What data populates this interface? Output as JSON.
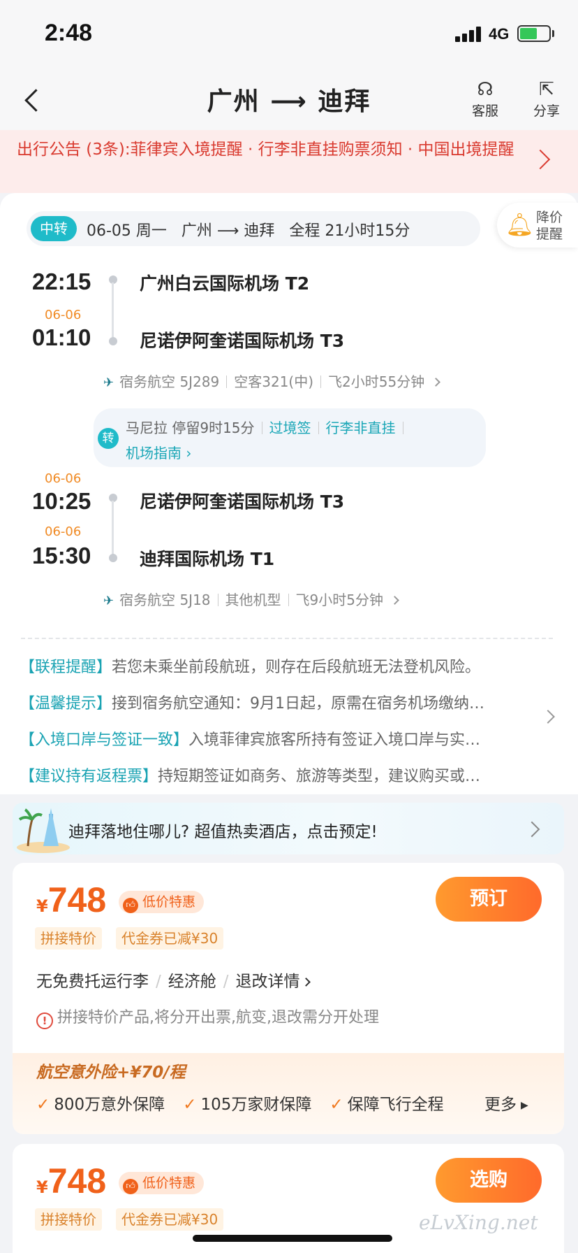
{
  "status_bar": {
    "time": "2:48",
    "network": "4G"
  },
  "header": {
    "title": "广州 ⟶ 迪拜",
    "service_label": "客服",
    "share_label": "分享"
  },
  "notice": {
    "text": "出行公告 (3条):菲律宾入境提醒 · 行李非直挂购票须知 · 中国出境提醒"
  },
  "summary": {
    "badge": "中转",
    "text": "06-05 周一   广州 ⟶ 迪拜   全程 21小时15分",
    "alert_label": "降价提醒"
  },
  "segments": [
    {
      "dep_time": "22:15",
      "dep_date": "",
      "dep_airport": "广州白云国际机场 T2",
      "arr_time": "01:10",
      "arr_date": "06-06",
      "arr_airport": "尼诺伊阿奎诺国际机场 T3",
      "airline": "宿务航空 5J289",
      "aircraft": "空客321(中)",
      "duration": "飞2小时55分钟"
    },
    {
      "dep_time": "10:25",
      "dep_date": "06-06",
      "dep_airport": "尼诺伊阿奎诺国际机场 T3",
      "arr_time": "15:30",
      "arr_date": "06-06",
      "arr_airport": "迪拜国际机场 T1",
      "airline": "宿务航空 5J18",
      "aircraft": "其他机型",
      "duration": "飞9小时5分钟"
    }
  ],
  "layover": {
    "badge": "转",
    "stay": "马尼拉 停留9时15分",
    "visa_link": "过境签",
    "baggage_link": "行李非直挂",
    "guide_link": "机场指南 ›"
  },
  "tips": [
    {
      "tag": "【联程提醒】",
      "text": "若您未乘坐前段航班，则存在后段航班无法登机风险。"
    },
    {
      "tag": "【温馨提示】",
      "text": "接到宿务航空通知：9月1日起，原需在宿务机场缴纳…"
    },
    {
      "tag": "【入境口岸与签证一致】",
      "text": "入境菲律宾旅客所持有签证入境口岸与实…"
    },
    {
      "tag": "【建议持有返程票】",
      "text": "持短期签证如商务、旅游等类型，建议购买或…"
    }
  ],
  "hotel_banner": {
    "text": "迪拜落地住哪儿? 超值热卖酒店，点击预定!"
  },
  "fares": [
    {
      "currency": "¥",
      "price": "748",
      "low_tag": "低价特惠",
      "tag1": "拼接特价",
      "tag2": "代金券已减¥30",
      "button": "预订",
      "baggage": "无免费托运行李",
      "cabin": "经济舱",
      "refund": "退改详情",
      "warning": "拼接特价产品,将分开出票,航变,退改需分开处理",
      "insurance_title": "航空意外险+¥70/程",
      "insurance_items": [
        "800万意外保障",
        "105万家财保障",
        "保障飞行全程"
      ],
      "insurance_more": "更多"
    },
    {
      "currency": "¥",
      "price": "748",
      "low_tag": "低价特惠",
      "tag1": "拼接特价",
      "tag2": "代金券已减¥30",
      "button": "选购"
    }
  ],
  "watermark": "eLvXing.net",
  "colors": {
    "accent": "#f0611a",
    "teal": "#1fbbc9",
    "notice_red": "#d93a2f"
  }
}
